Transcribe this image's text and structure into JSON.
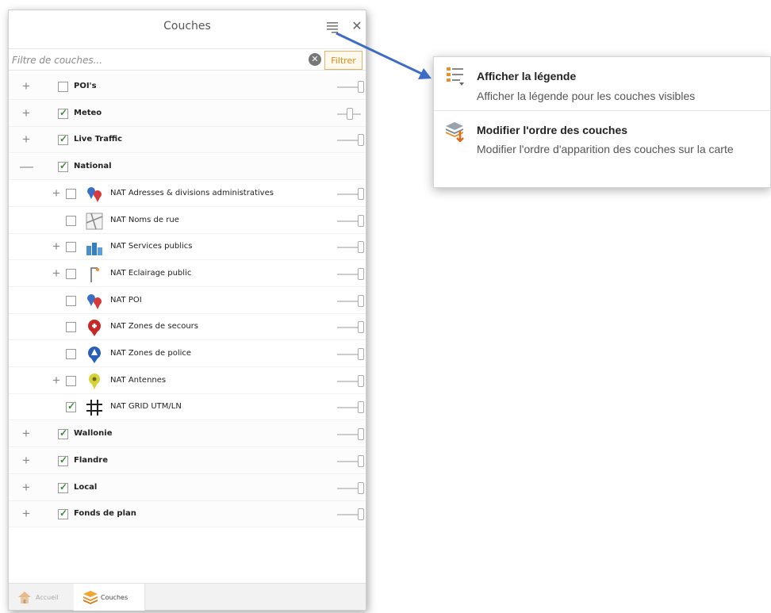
{
  "panel": {
    "title": "Couches",
    "filter": {
      "placeholder": "Filtre de couches...",
      "button_label": "Filtrer"
    },
    "layers": [
      {
        "label": "POI's",
        "checked": false,
        "level": 0,
        "expandable": true
      },
      {
        "label": "Meteo",
        "checked": true,
        "level": 0,
        "expandable": true
      },
      {
        "label": "Live Traffic",
        "checked": true,
        "level": 0,
        "expandable": true
      },
      {
        "label": "National",
        "checked": true,
        "level": 0,
        "expandable": true,
        "expanded": true
      },
      {
        "label": "NAT Adresses & divisions administratives",
        "checked": false,
        "level": 1,
        "expandable": true,
        "icon": "map-pins-icon"
      },
      {
        "label": "NAT Noms de rue",
        "checked": false,
        "level": 1,
        "expandable": false,
        "icon": "street-map-icon"
      },
      {
        "label": "NAT Services publics",
        "checked": false,
        "level": 1,
        "expandable": true,
        "icon": "buildings-icon"
      },
      {
        "label": "NAT Eclairage public",
        "checked": false,
        "level": 1,
        "expandable": true,
        "icon": "street-light-icon"
      },
      {
        "label": "NAT POI",
        "checked": false,
        "level": 1,
        "expandable": false,
        "icon": "map-pins-icon"
      },
      {
        "label": "NAT Zones de secours",
        "checked": false,
        "level": 1,
        "expandable": false,
        "icon": "rescue-pin-icon"
      },
      {
        "label": "NAT Zones de police",
        "checked": false,
        "level": 1,
        "expandable": false,
        "icon": "police-pin-icon"
      },
      {
        "label": "NAT Antennes",
        "checked": false,
        "level": 1,
        "expandable": true,
        "icon": "antenna-pin-icon"
      },
      {
        "label": "NAT GRID UTM/LN",
        "checked": true,
        "level": 1,
        "expandable": false,
        "icon": "grid-icon"
      },
      {
        "label": "Wallonie",
        "checked": true,
        "level": 0,
        "expandable": true
      },
      {
        "label": "Flandre",
        "checked": true,
        "level": 0,
        "expandable": true
      },
      {
        "label": "Local",
        "checked": true,
        "level": 0,
        "expandable": true
      },
      {
        "label": "Fonds de plan",
        "checked": true,
        "level": 0,
        "expandable": true
      }
    ],
    "footer": {
      "home_tab": "Accueil",
      "layers_tab": "Couches"
    }
  },
  "menu": {
    "item1": {
      "title": "Afficher la légende",
      "description": "Afficher la légende pour les couches visibles",
      "icon": "legend-list-icon"
    },
    "item2": {
      "title": "Modifier l'ordre des couches",
      "description": "Modifier l'ordre d'apparition des couches sur la carte",
      "icon": "layer-order-icon"
    }
  },
  "colors": {
    "accent": "#e8a03a",
    "arrow": "#3c6cc4",
    "check": "#3a8a3a"
  }
}
